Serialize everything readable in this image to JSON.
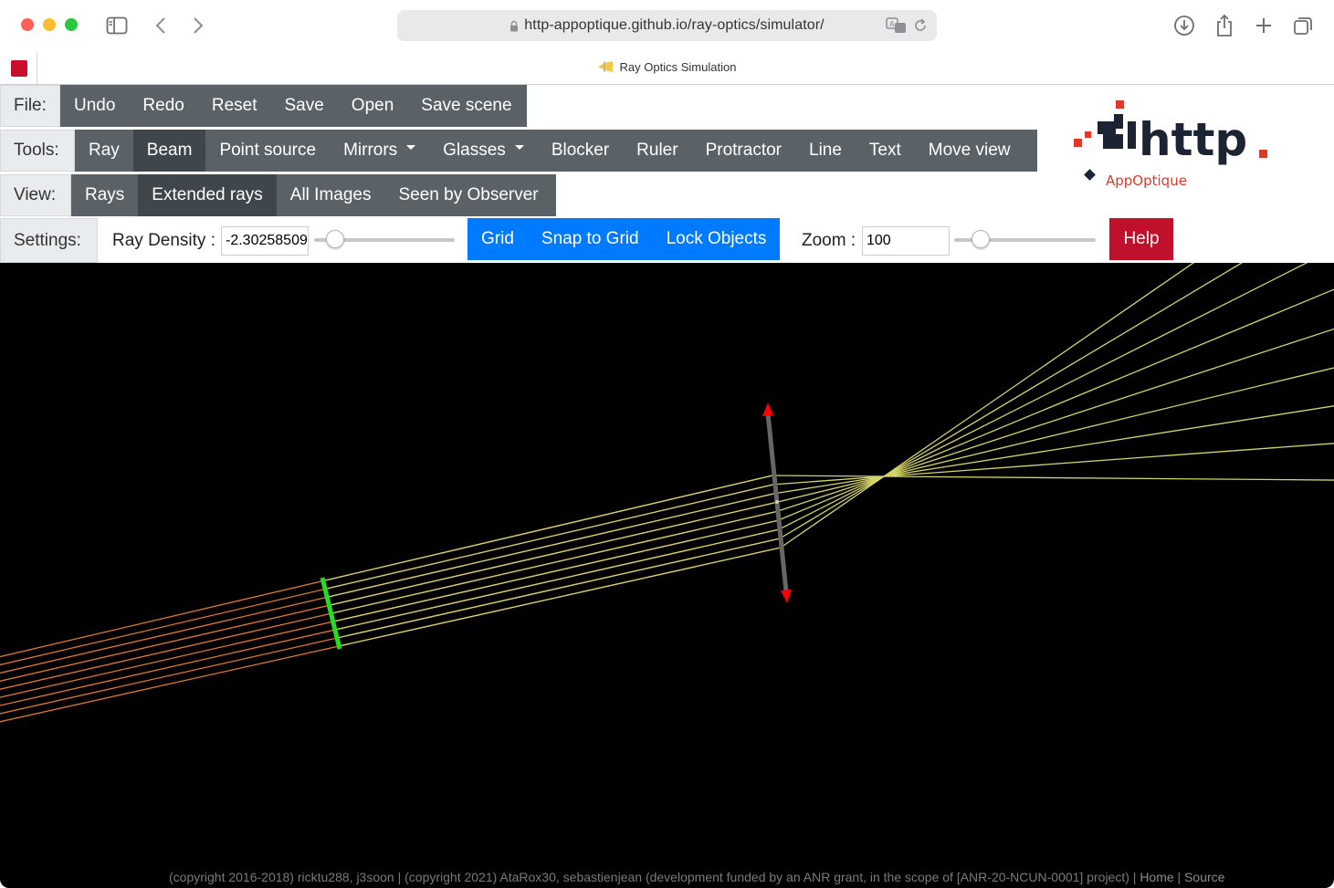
{
  "browser": {
    "url": "http-appoptique.github.io/ray-optics/simulator/",
    "tab_title": "Ray Optics Simulation"
  },
  "toolbar": {
    "file_label": "File:",
    "file_buttons": [
      "Undo",
      "Redo",
      "Reset",
      "Save",
      "Open",
      "Save scene"
    ],
    "tools_label": "Tools:",
    "tools_buttons": [
      "Ray",
      "Beam",
      "Point source",
      "Mirrors",
      "Glasses",
      "Blocker",
      "Ruler",
      "Protractor",
      "Line",
      "Text",
      "Move view"
    ],
    "tools_active": "Beam",
    "view_label": "View:",
    "view_buttons": [
      "Rays",
      "Extended rays",
      "All Images",
      "Seen by Observer"
    ],
    "view_active": "Extended rays"
  },
  "settings": {
    "label": "Settings:",
    "ray_density_label": "Ray Density :",
    "ray_density_value": "-2.302585092994046",
    "grid_label": "Grid",
    "snap_label": "Snap to Grid",
    "lock_label": "Lock Objects",
    "zoom_label": "Zoom :",
    "zoom_value": "100",
    "help_label": "Help"
  },
  "logo": {
    "text": "http",
    "subtitle": "AppOptique",
    "accent_color": "#e2382a",
    "dark_color": "#1c2333"
  },
  "colors": {
    "toolbar_button": "#5a6268",
    "toolbar_active": "#3f464c",
    "toggle_blue": "#007bff",
    "help_red": "#c0102c",
    "canvas_bg": "#000000",
    "ray_color": "#d4d46a",
    "extended_ray_color": "#e0782e",
    "beam_source_color": "#22dd22",
    "lens_color": "#666666",
    "lens_arrow_color": "#ff0000"
  },
  "footer": {
    "text": "(copyright 2016-2018) ricktu288, j3soon | (copyright 2021) AtaRox30, sebastienjean (development funded by an ANR grant, in the scope of [ANR-20-NCUN-0001] project) | ",
    "home_link": "Home",
    "separator": " | ",
    "source_link": "Source"
  }
}
